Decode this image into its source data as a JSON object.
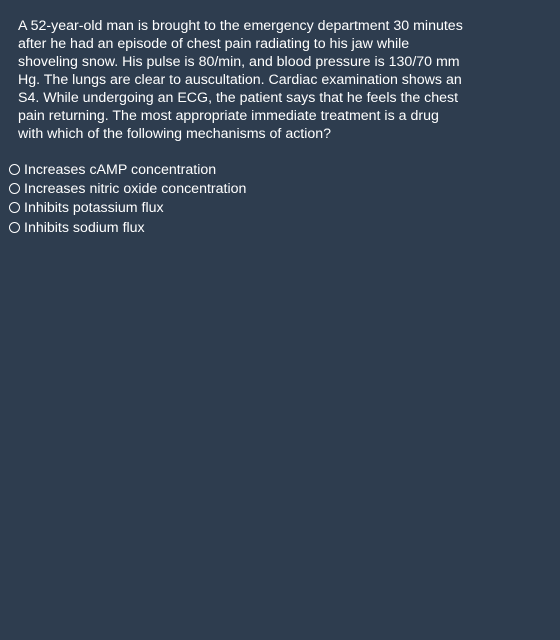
{
  "question": {
    "lines": [
      "A 52-year-old man is brought to the emergency department 30 minutes",
      "after he had an episode of chest pain radiating to his jaw while",
      "shoveling snow. His pulse is 80/min, and blood pressure is 130/70 mm",
      "Hg. The lungs are clear to auscultation. Cardiac examination shows an",
      "S4. While undergoing an ECG, the patient says that he feels the chest",
      "pain returning. The most appropriate immediate treatment is a drug",
      "with which of the following mechanisms of action?"
    ]
  },
  "options": [
    {
      "label": "Increases cAMP concentration",
      "selected": false
    },
    {
      "label": "Increases nitric oxide concentration",
      "selected": false
    },
    {
      "label": "Inhibits potassium flux",
      "selected": false
    },
    {
      "label": "Inhibits sodium flux",
      "selected": false
    }
  ],
  "icons": {
    "radio": "radio-unchecked-icon"
  },
  "colors": {
    "background": "#2e3d4f",
    "text": "#ffffff"
  }
}
